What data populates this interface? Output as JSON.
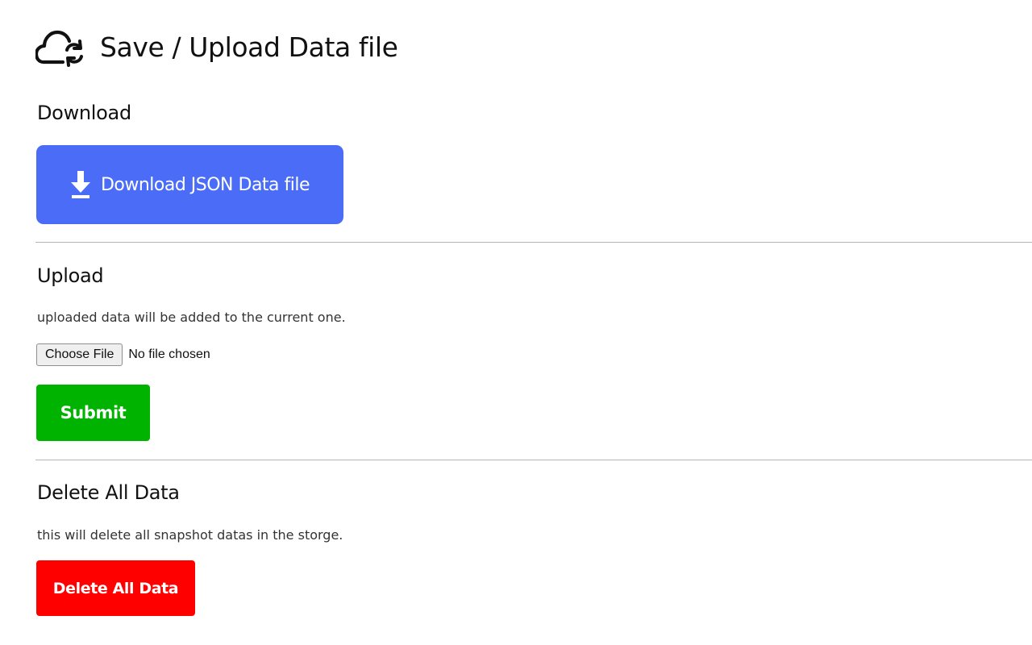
{
  "header": {
    "title": "Save / Upload Data file",
    "icon": "cloud-sync-icon"
  },
  "download": {
    "section_title": "Download",
    "button_label": "Download JSON Data file",
    "button_icon": "download-arrow-icon",
    "button_color": "#4a6cf7"
  },
  "upload": {
    "section_title": "Upload",
    "description": "uploaded data will be added to the current one.",
    "file_button_label": "Choose File",
    "file_status": "No file chosen",
    "submit_label": "Submit",
    "submit_color": "#00b300"
  },
  "delete": {
    "section_title": "Delete All Data",
    "description": "this will delete all snapshot datas in the storge.",
    "button_label": "Delete All Data",
    "button_color": "#ff0000"
  }
}
